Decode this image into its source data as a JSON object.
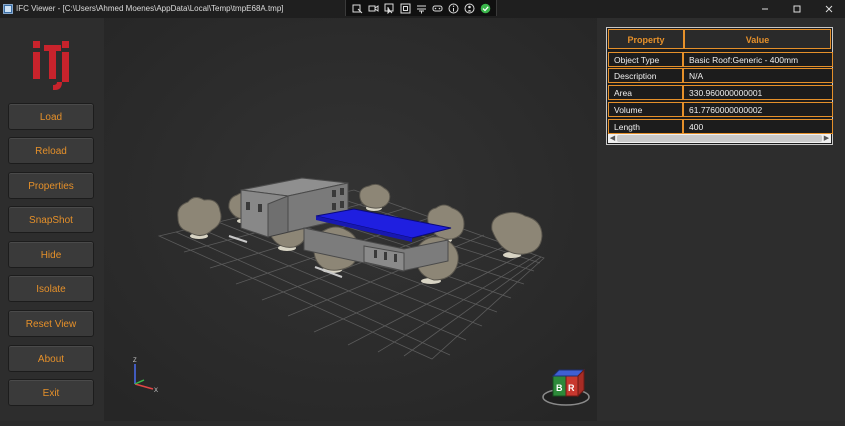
{
  "window": {
    "title": "IFC Viewer - [C:\\Users\\Ahmed Moenes\\AppData\\Local\\Temp\\tmpE68A.tmp]",
    "toolbar_icons": [
      "select-icon",
      "camera-icon",
      "pointer-icon",
      "frame-icon",
      "fit-icon",
      "gamepad-icon",
      "info-icon",
      "person-icon",
      "check-icon"
    ],
    "controls": [
      "minimize-icon",
      "maximize-icon",
      "close-icon"
    ]
  },
  "sidebar": {
    "logo": "iti",
    "buttons": [
      {
        "label": "Load"
      },
      {
        "label": "Reload"
      },
      {
        "label": "Properties"
      },
      {
        "label": "SnapShot"
      },
      {
        "label": "Hide"
      },
      {
        "label": "Isolate"
      },
      {
        "label": "Reset View"
      },
      {
        "label": "About"
      },
      {
        "label": "Exit"
      }
    ]
  },
  "viewport": {
    "axes": {
      "z": "Z",
      "x": "X"
    },
    "view_cube": {
      "faces": [
        "B",
        "R"
      ]
    }
  },
  "properties": {
    "headers": {
      "property": "Property",
      "value": "Value"
    },
    "rows": [
      {
        "property": "Object Type",
        "value": "Basic Roof:Generic - 400mm"
      },
      {
        "property": "Description",
        "value": "N/A"
      },
      {
        "property": "Area",
        "value": "330.960000000001"
      },
      {
        "property": "Volume",
        "value": "61.7760000000002"
      },
      {
        "property": "Length",
        "value": "400"
      }
    ]
  },
  "colors": {
    "accent": "#e5902a",
    "selected_roof": "#1f1fe0",
    "background": "#2b2b2b"
  }
}
